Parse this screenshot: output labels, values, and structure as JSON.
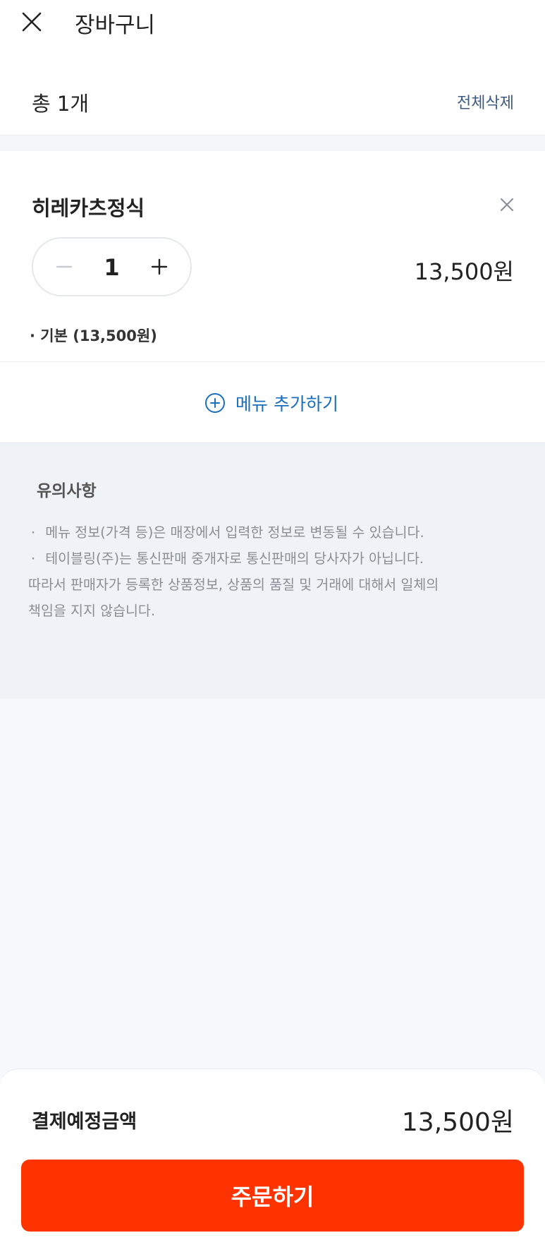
{
  "header": {
    "title": "장바구니",
    "close_icon": "close-icon"
  },
  "summary": {
    "total_count": "총 1개",
    "delete_all": "전체삭제"
  },
  "cart": {
    "items": [
      {
        "name": "히레카츠정식",
        "quantity": "1",
        "price": "13,500원",
        "option": "· 기본 (13,500원)"
      }
    ],
    "add_menu_label": "메뉴 추가하기"
  },
  "notice": {
    "title": "유의사항",
    "lines": [
      "메뉴 정보(가격 등)은 매장에서 입력한 정보로 변동될 수 있습니다.",
      "테이블링(주)는 통신판매 중개자로 통신판매의 당사자가 아닙니다.",
      "따라서 판매자가 등록한 상품정보, 상품의 품질 및 거래에 대해서 일체의",
      "책임을 지지 않습니다."
    ]
  },
  "checkout": {
    "pay_label": "결제예정금액",
    "pay_amount": "13,500원",
    "order_button": "주문하기"
  },
  "colors": {
    "accent": "#ff3300",
    "link": "#1a6fbf",
    "notice_bg": "#eff3f7"
  }
}
